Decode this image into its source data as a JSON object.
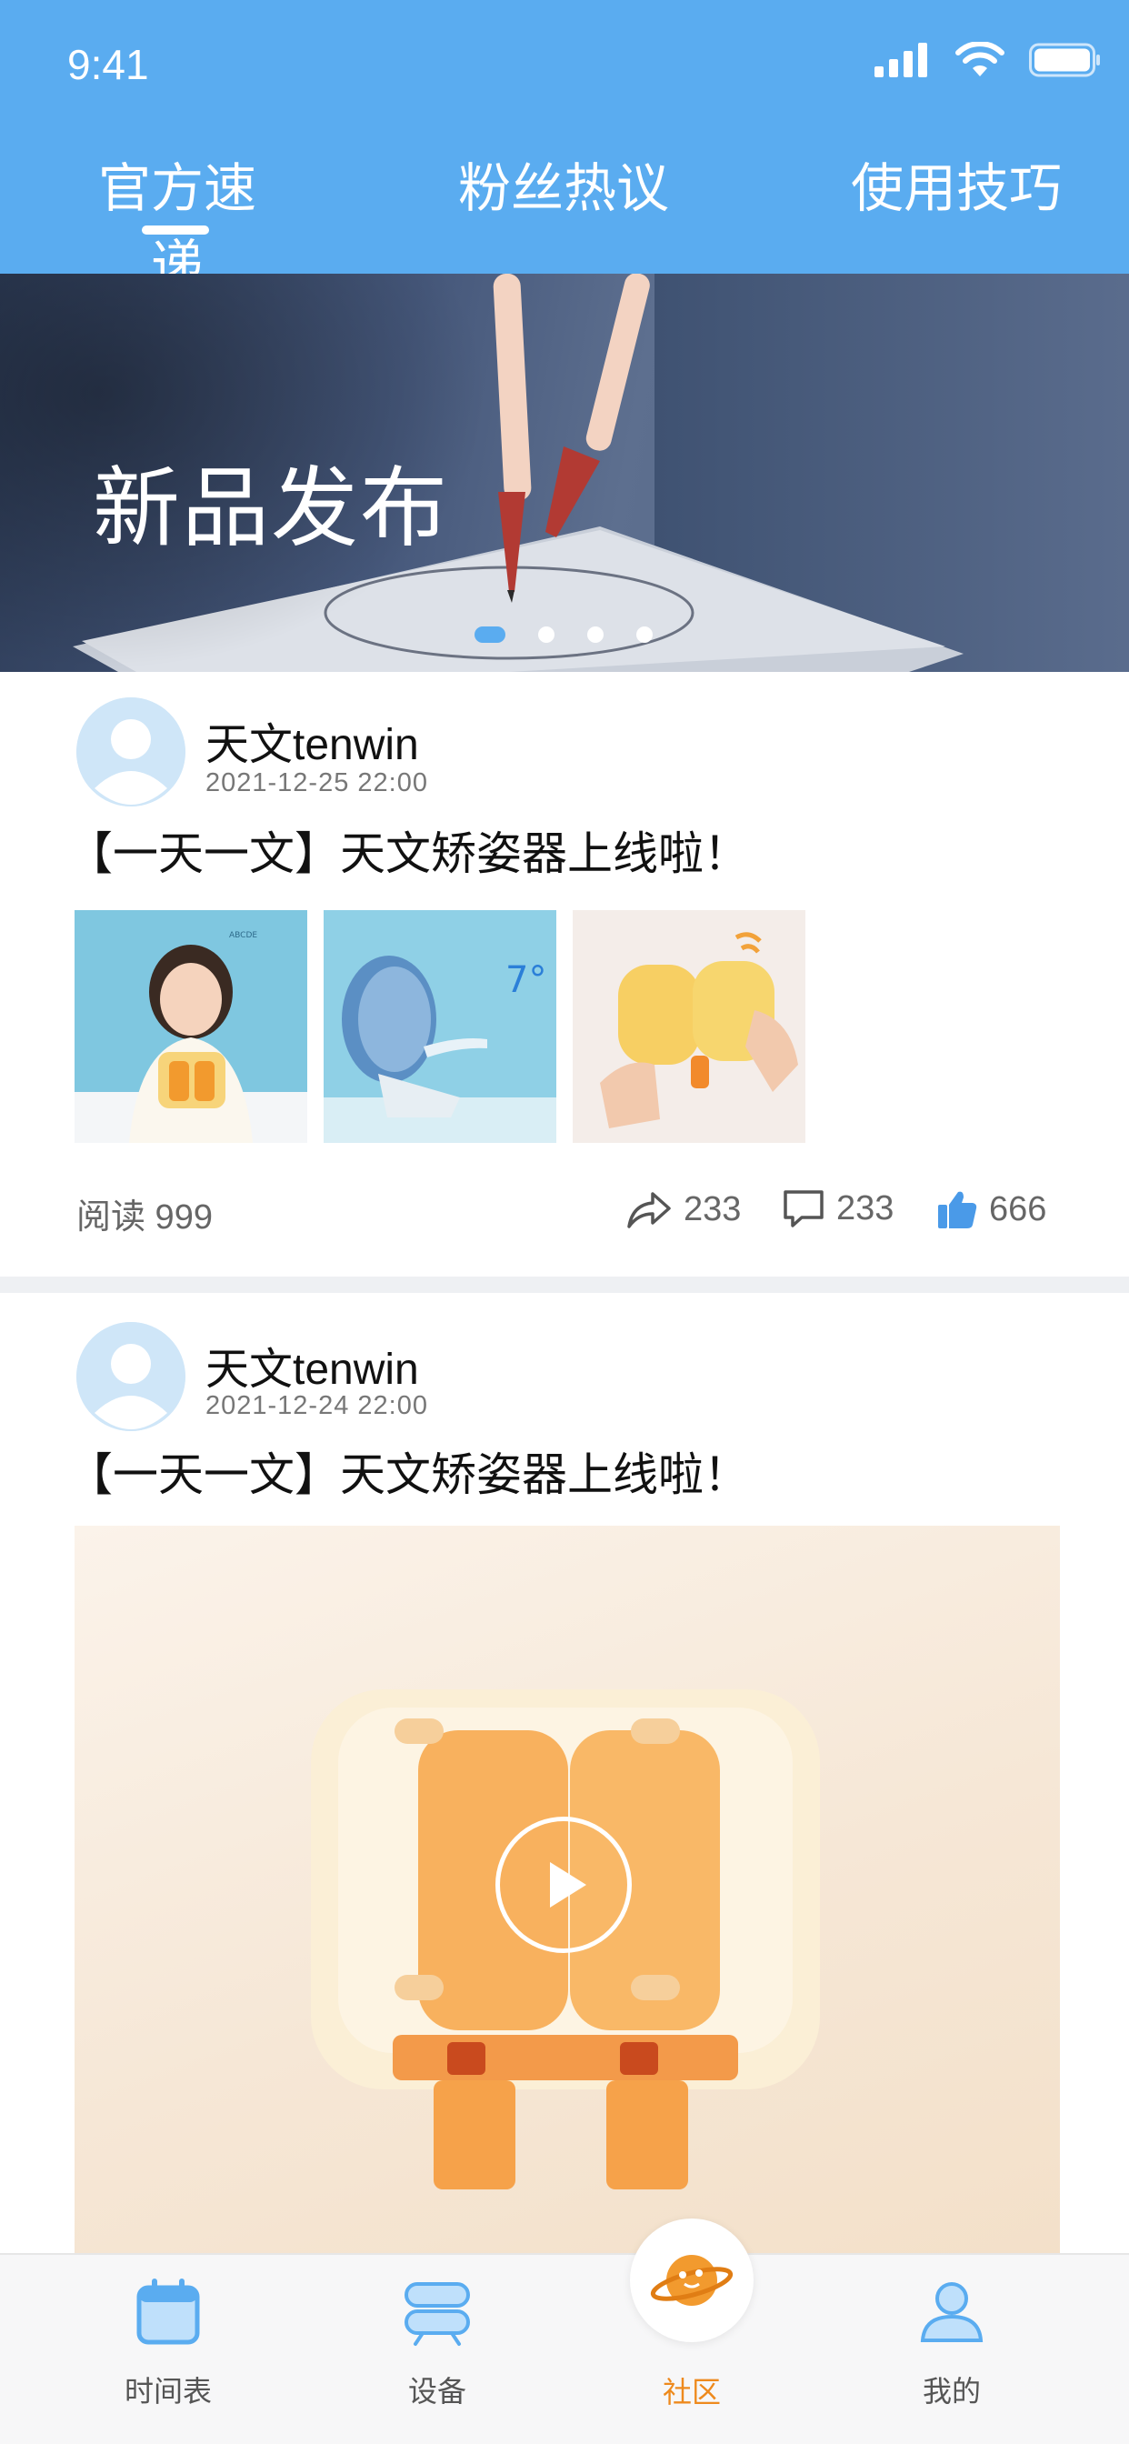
{
  "status_bar": {
    "time": "9:41"
  },
  "tabs": [
    {
      "label": "官方速递",
      "active": true
    },
    {
      "label": "粉丝热议",
      "active": false
    },
    {
      "label": "使用技巧",
      "active": false
    }
  ],
  "banner": {
    "title": "新品发布",
    "slides": 4,
    "active_slide": 1
  },
  "posts": [
    {
      "author": "天文tenwin",
      "date": "2021-12-25  22:00",
      "title": "【一天一文】天文矫姿器上线啦！",
      "media": "images",
      "images": [
        "girl-with-posture-corrector",
        "posture-corrector-side-view",
        "posture-corrector-in-hand"
      ],
      "stats": {
        "read": "阅读 999",
        "shares": "233",
        "comments": "233",
        "likes": "666"
      }
    },
    {
      "author": "天文tenwin",
      "date": "2021-12-24  22:00",
      "title": "【一天一文】天文矫姿器上线啦！",
      "media": "video"
    }
  ],
  "bottom_nav": [
    {
      "label": "时间表",
      "icon": "calendar-icon",
      "active": false
    },
    {
      "label": "设备",
      "icon": "device-icon",
      "active": false
    },
    {
      "label": "社区",
      "icon": "planet-icon",
      "active": true
    },
    {
      "label": "我的",
      "icon": "user-icon",
      "active": false
    }
  ],
  "colors": {
    "primary": "#5aacf0",
    "active_nav": "#ee8a1d"
  }
}
